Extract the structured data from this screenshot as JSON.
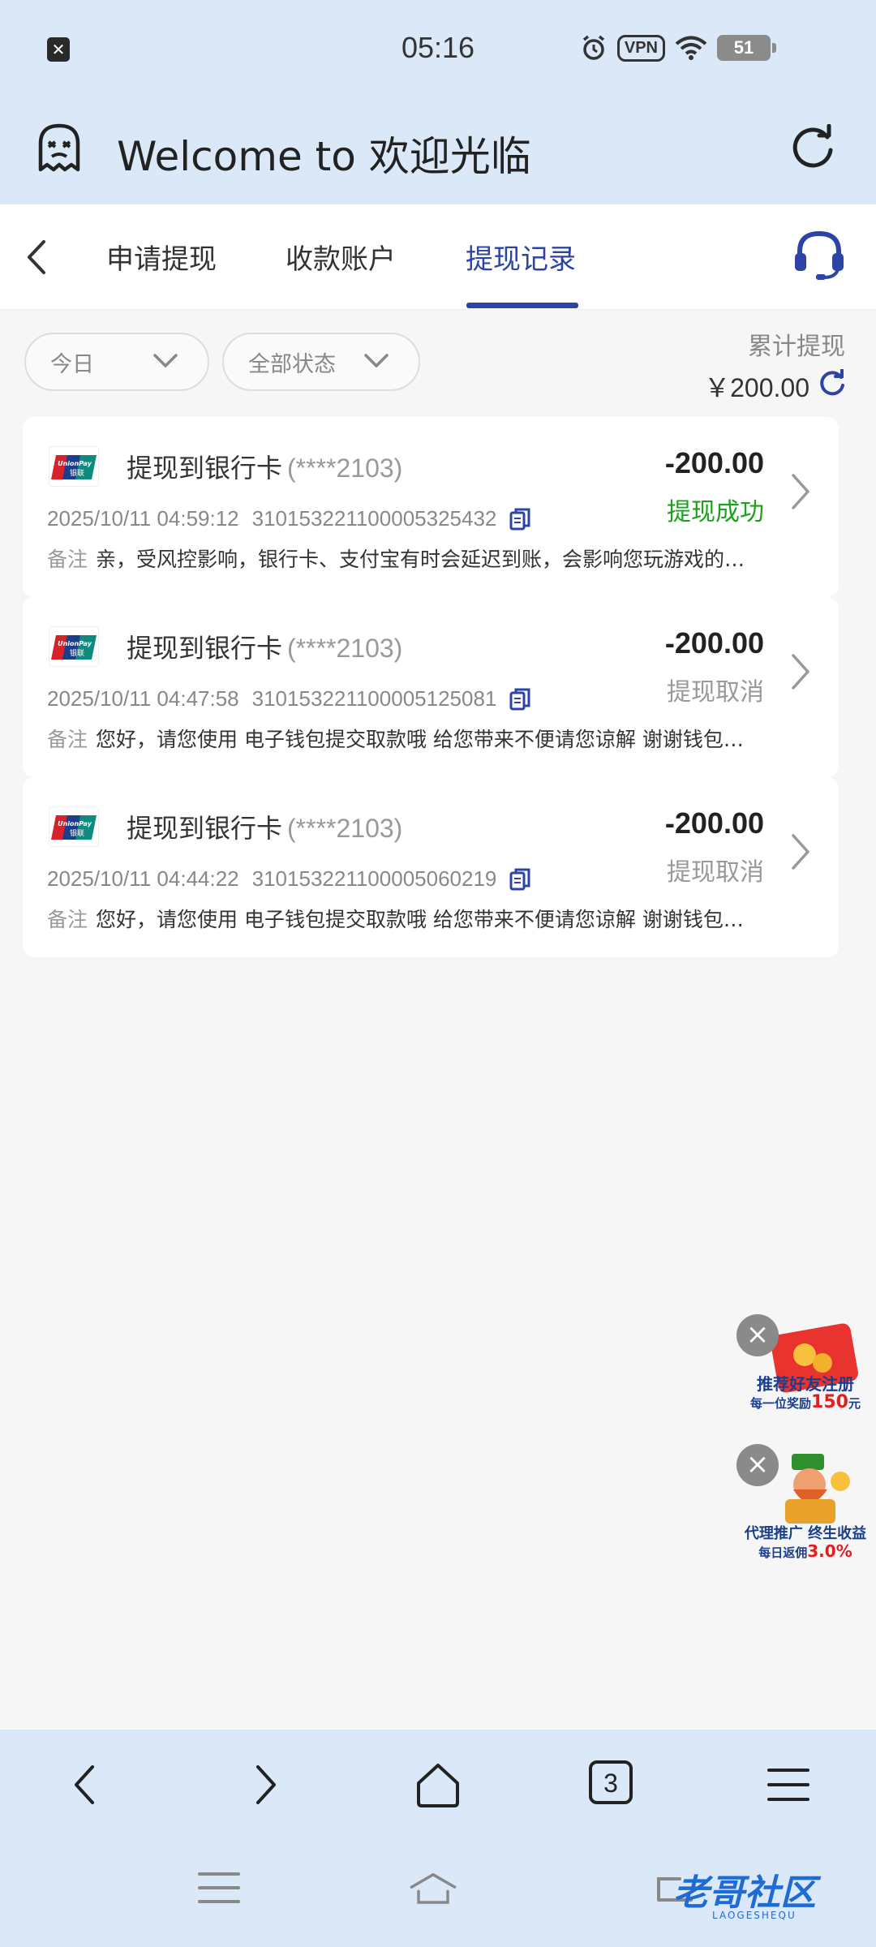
{
  "status_bar": {
    "time": "05:16",
    "vpn_label": "VPN",
    "battery": "51"
  },
  "browser": {
    "title": "Welcome to 欢迎光临"
  },
  "tabs": [
    {
      "label": "申请提现",
      "active": false
    },
    {
      "label": "收款账户",
      "active": false
    },
    {
      "label": "提现记录",
      "active": true
    }
  ],
  "filters": {
    "date": "今日",
    "status": "全部状态"
  },
  "summary": {
    "label": "累计提现",
    "value": "￥200.00"
  },
  "records": [
    {
      "title": "提现到银行卡",
      "account": "(****2103)",
      "amount": "-200.00",
      "status": "提现成功",
      "status_color": "#1aa31a",
      "time": "2025/10/11 04:59:12",
      "order_no": "31015322110000532543​2",
      "note_label": "备注",
      "note": "亲，受风控影响，银行卡、支付宝有时会延迟到账，会影响您玩游戏的…"
    },
    {
      "title": "提现到银行卡",
      "account": "(****2103)",
      "amount": "-200.00",
      "status": "提现取消",
      "status_color": "#999999",
      "time": "2025/10/11 04:47:58",
      "order_no": "310153221100005125081",
      "note_label": "备注",
      "note": "您好，请您使用 电子钱包提交取款哦 给您带来不便请您谅解 谢谢钱包…"
    },
    {
      "title": "提现到银行卡",
      "account": "(****2103)",
      "amount": "-200.00",
      "status": "提现取消",
      "status_color": "#999999",
      "time": "2025/10/11 04:44:22",
      "order_no": "310153221100005060219",
      "note_label": "备注",
      "note": "您好，请您使用 电子钱包提交取款哦 给您带来不便请您谅解 谢谢钱包…"
    }
  ],
  "promos": [
    {
      "line1": "推荐好友注册",
      "line2": "每一位奖励",
      "highlight": "150",
      "suffix": "元"
    },
    {
      "line1": "代理推广 终生收益",
      "line2": "每日返佣",
      "highlight": "3.0%",
      "suffix": ""
    }
  ],
  "bottom_nav": {
    "tab_count": "3"
  },
  "watermark": {
    "text": "老哥社区",
    "sub": "LAOGESHEQU"
  },
  "colors": {
    "accent": "#2c44a6",
    "header_bg": "#dbe8f8",
    "success": "#1aa31a"
  }
}
